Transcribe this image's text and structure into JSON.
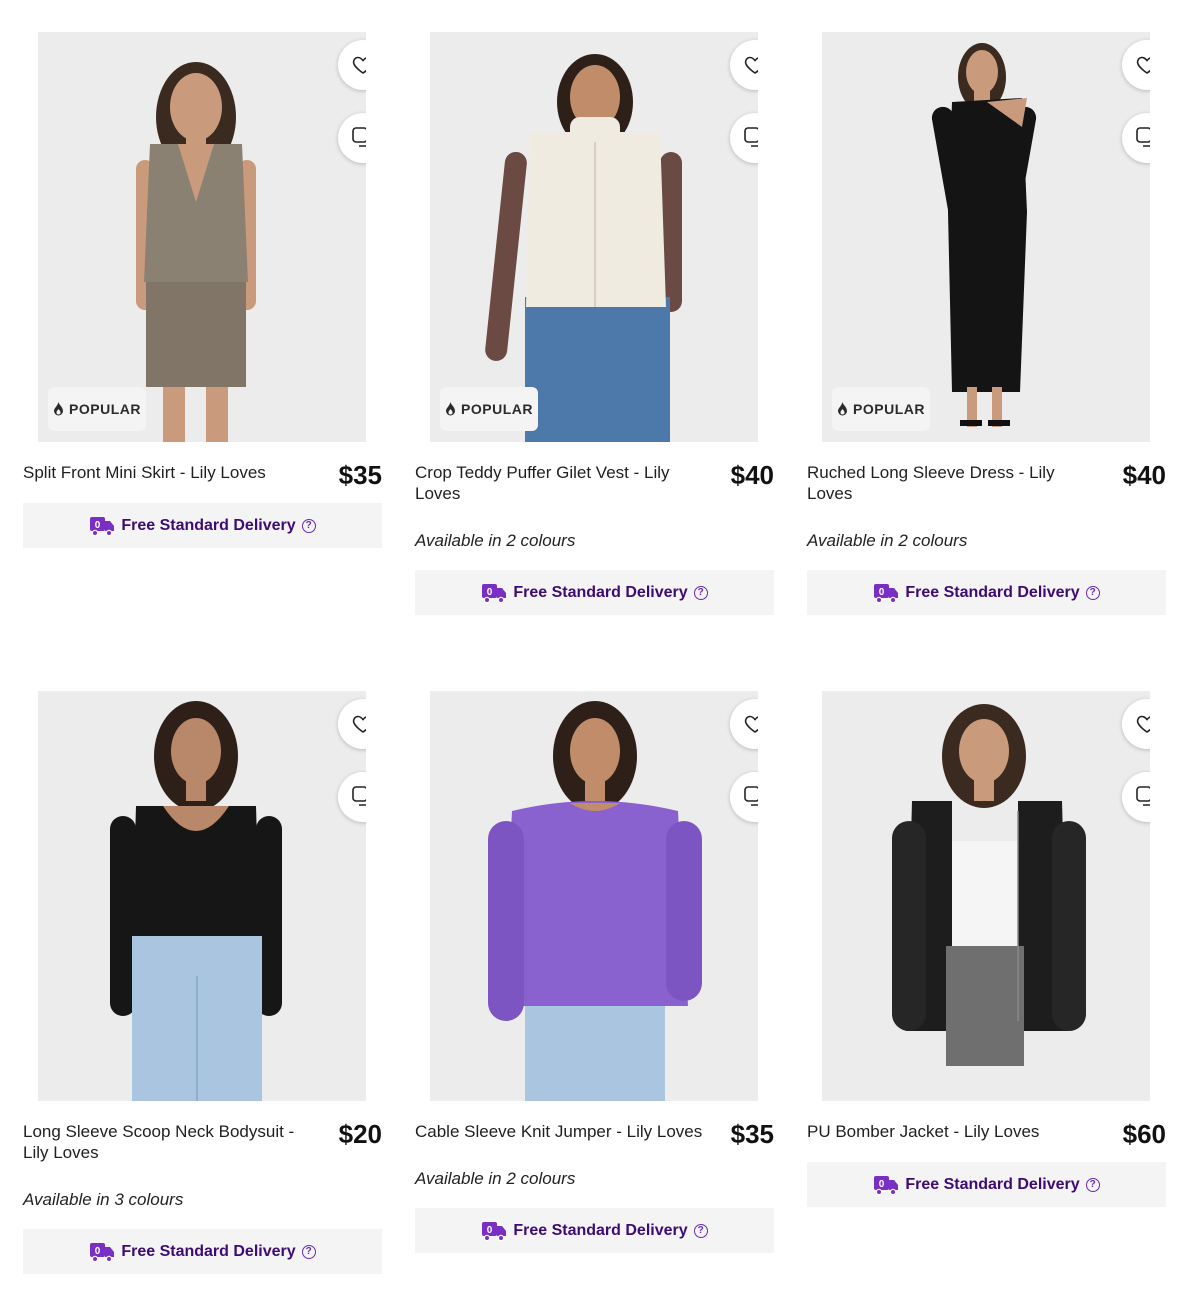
{
  "products": [
    {
      "name": "Split Front Mini Skirt - Lily Loves",
      "price": "$35",
      "badge": "POPULAR",
      "colours": "",
      "delivery": "Free Standard Delivery",
      "outfit": {
        "top": "#8b8172",
        "bottom": "#8b8172",
        "sleeve": "",
        "hair": "#3b2a20"
      }
    },
    {
      "name": "Crop Teddy Puffer Gilet Vest - Lily Loves",
      "price": "$40",
      "badge": "POPULAR",
      "colours": "Available in 2 colours",
      "delivery": "Free Standard Delivery",
      "outfit": {
        "top": "#efebe1",
        "bottom": "#4d79aa",
        "sleeve": "#6a4a42",
        "hair": "#2e2019"
      }
    },
    {
      "name": "Ruched Long Sleeve Dress - Lily Loves",
      "price": "$40",
      "badge": "POPULAR",
      "colours": "Available in 2 colours",
      "delivery": "Free Standard Delivery",
      "outfit": {
        "top": "#141414",
        "bottom": "#141414",
        "sleeve": "#141414",
        "hair": "#3b2a20"
      }
    },
    {
      "name": "Long Sleeve Scoop Neck Bodysuit - Lily Loves",
      "price": "$20",
      "badge": "",
      "colours": "Available in 3 colours",
      "delivery": "Free Standard Delivery",
      "outfit": {
        "top": "#161616",
        "bottom": "#a9c5df",
        "sleeve": "#161616",
        "hair": "#2e2019"
      }
    },
    {
      "name": "Cable Sleeve Knit Jumper - Lily Loves",
      "price": "$35",
      "badge": "",
      "colours": "Available in 2 colours",
      "delivery": "Free Standard Delivery",
      "outfit": {
        "top": "#8a62cf",
        "bottom": "#a9c5df",
        "sleeve": "#8a62cf",
        "hair": "#2e2019"
      }
    },
    {
      "name": "PU Bomber Jacket - Lily Loves",
      "price": "$60",
      "badge": "",
      "colours": "",
      "delivery": "Free Standard Delivery",
      "outfit": {
        "top": "#1d1d1d",
        "bottom": "#6f6f6f",
        "sleeve": "#1d1d1d",
        "hair": "#3b2a20"
      }
    }
  ],
  "icons": {
    "favourite": "heart-icon",
    "compare": "compare-icon",
    "popular": "flame-icon",
    "delivery": "delivery-truck-icon",
    "info": "question-icon"
  },
  "colors": {
    "delivery_text": "#3d0b73",
    "delivery_icon": "#7a2fc4",
    "delivery_bg": "#f4f4f5",
    "image_bg": "#ececec"
  }
}
